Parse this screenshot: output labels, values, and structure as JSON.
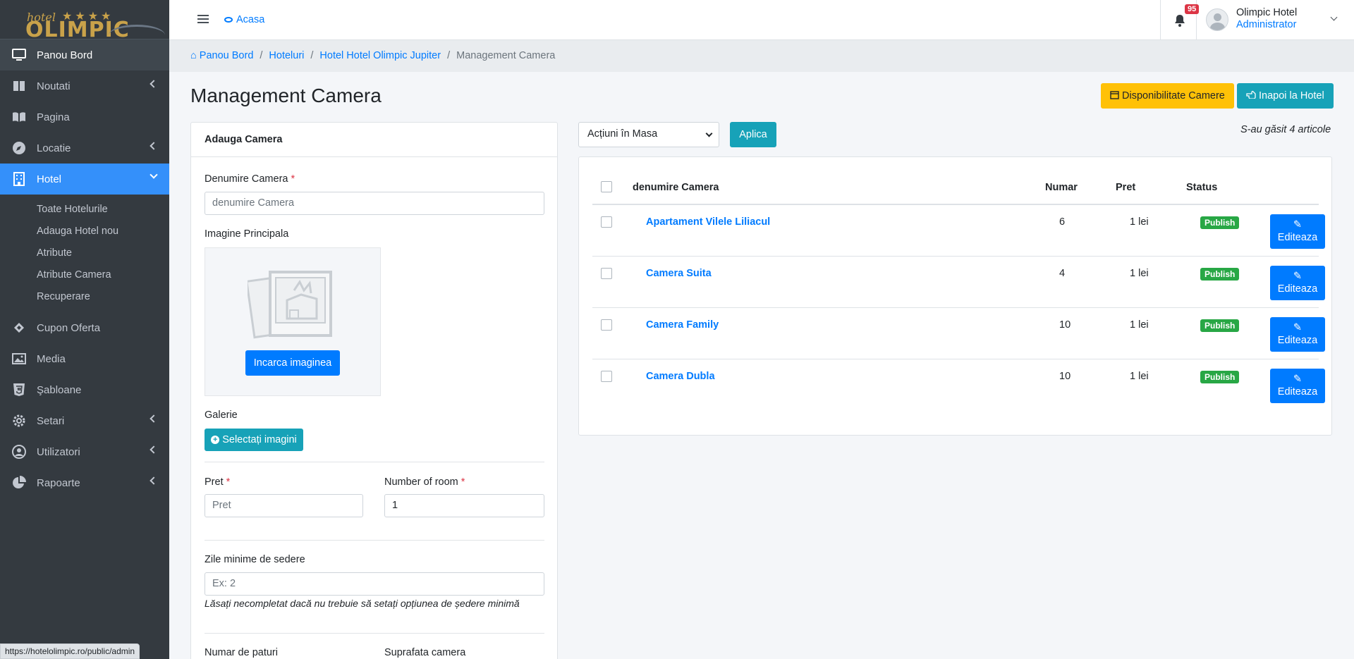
{
  "brand": {
    "small": "hotel",
    "stars": "★★★★",
    "big": "OLIMPIC"
  },
  "sidebar": {
    "items": [
      {
        "label": "Panou Bord"
      },
      {
        "label": "Noutati"
      },
      {
        "label": "Pagina"
      },
      {
        "label": "Locatie"
      },
      {
        "label": "Hotel"
      },
      {
        "label": "Cupon Oferta"
      },
      {
        "label": "Media"
      },
      {
        "label": "Şabloane"
      },
      {
        "label": "Setari"
      },
      {
        "label": "Utilizatori"
      },
      {
        "label": "Rapoarte"
      }
    ],
    "hotel_sub": [
      {
        "label": "Toate Hotelurile"
      },
      {
        "label": "Adauga Hotel nou"
      },
      {
        "label": "Atribute"
      },
      {
        "label": "Atribute Camera"
      },
      {
        "label": "Recuperare"
      }
    ]
  },
  "statusbar": {
    "url": "https://hotelolimpic.ro/public/admin"
  },
  "header": {
    "home_label": "Acasa",
    "notif_count": "95",
    "user_name": "Olimpic Hotel",
    "user_role": "Administrator"
  },
  "breadcrumb": {
    "c1": "Panou Bord",
    "c2": "Hoteluri",
    "c3": "Hotel Hotel Olimpic Jupiter",
    "current": "Management Camera"
  },
  "page": {
    "title": "Management Camera",
    "btn_availability": "Disponibilitate Camere",
    "btn_back": "Inapoi la Hotel"
  },
  "form": {
    "card_title": "Adauga Camera",
    "name_label": "Denumire Camera",
    "name_placeholder": "denumire Camera",
    "image_label": "Imagine Principala",
    "upload_btn": "Incarca imaginea",
    "gallery_label": "Galerie",
    "gallery_btn": "Selectați imagini",
    "price_label": "Pret",
    "price_placeholder": "Pret",
    "rooms_label": "Number of room",
    "rooms_value": "1",
    "minstay_label": "Zile minime de sedere",
    "minstay_placeholder": "Ex: 2",
    "minstay_hint": "Lăsați necompletat dacă nu trebuie să setați opțiunea de ședere minimă",
    "beds_label": "Numar de paturi",
    "area_label": "Suprafata camera"
  },
  "bulk": {
    "select_value": "Acțiuni în Masa",
    "apply": "Aplica",
    "found": "S-au găsit 4 articole"
  },
  "table": {
    "headers": {
      "name": "denumire Camera",
      "number": "Numar",
      "price": "Pret",
      "status": "Status"
    },
    "edit_label": "Editeaza",
    "rows": [
      {
        "name": "Apartament Vilele Liliacul",
        "number": "6",
        "price": "1 lei",
        "status": "Publish"
      },
      {
        "name": "Camera Suita",
        "number": "4",
        "price": "1 lei",
        "status": "Publish"
      },
      {
        "name": "Camera Family",
        "number": "10",
        "price": "1 lei",
        "status": "Publish"
      },
      {
        "name": "Camera Dubla",
        "number": "10",
        "price": "1 lei",
        "status": "Publish"
      }
    ]
  },
  "colors": {
    "sidebar": "#343a40",
    "active": "#3490fa",
    "primary": "#007bff",
    "warning": "#ffc107",
    "info": "#17a2b8",
    "success": "#28a745",
    "danger": "#dc3545"
  }
}
